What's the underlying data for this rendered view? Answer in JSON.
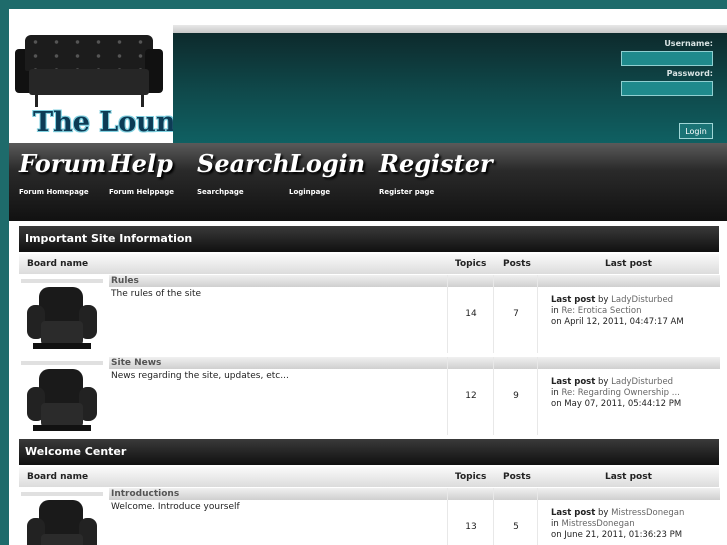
{
  "header": {
    "logo_text": "The Lounge",
    "username_label": "Username:",
    "password_label": "Password:",
    "login_button": "Login"
  },
  "nav": [
    {
      "title": "Forum",
      "subtitle": "Forum Homepage"
    },
    {
      "title": "Help",
      "subtitle": "Forum Helppage"
    },
    {
      "title": "Search",
      "subtitle": "Searchpage"
    },
    {
      "title": "Login",
      "subtitle": "Loginpage"
    },
    {
      "title": "Register",
      "subtitle": "Register page"
    }
  ],
  "table_headers": {
    "board": "Board name",
    "topics": "Topics",
    "posts": "Posts",
    "last_post": "Last post"
  },
  "categories": [
    {
      "title": "Important Site Information",
      "boards": [
        {
          "name": "Rules",
          "desc": "The rules of the site",
          "topics": "14",
          "posts": "7",
          "last_post_label": "Last post",
          "by": "by",
          "author": "LadyDisturbed",
          "in": "in",
          "subject": "Re: Erotica Section",
          "date": "on April 12, 2011, 04:47:17 AM"
        },
        {
          "name": "Site News",
          "desc": "News regarding the site, updates, etc...",
          "topics": "12",
          "posts": "9",
          "last_post_label": "Last post",
          "by": "by",
          "author": "LadyDisturbed",
          "in": "in",
          "subject": "Re: Regarding Ownership ...",
          "date": "on May 07, 2011, 05:44:12 PM"
        }
      ]
    },
    {
      "title": "Welcome Center",
      "boards": [
        {
          "name": "Introductions",
          "desc": "Welcome. Introduce yourself",
          "topics": "13",
          "posts": "5",
          "last_post_label": "Last post",
          "by": "by",
          "author": "MistressDonegan",
          "in": "in",
          "subject": "MistressDonegan",
          "date": "on June 21, 2011, 01:36:23 PM"
        }
      ]
    }
  ]
}
